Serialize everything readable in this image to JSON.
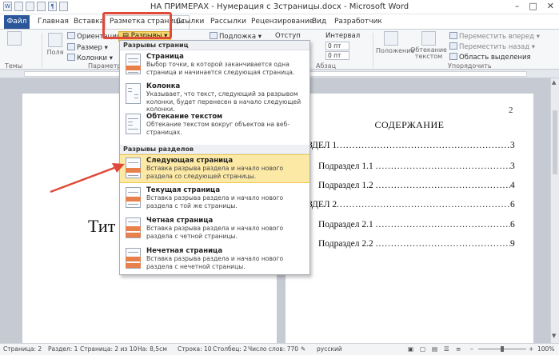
{
  "window": {
    "title": "НА ПРИМЕРАХ - Нумерация с 3страницы.docx - Microsoft Word",
    "controls": [
      "–",
      "□",
      "✕"
    ],
    "qat_icons": [
      "word-logo-icon",
      "save-icon",
      "undo-icon",
      "redo-icon",
      "paragraph-mark-icon",
      "format-painter-icon"
    ]
  },
  "tabs": [
    "Файл",
    "Главная",
    "Вставка",
    "Разметка страницы",
    "Ссылки",
    "Рассылки",
    "Рецензирование",
    "Вид",
    "Разработчик"
  ],
  "ribbon": {
    "themes_label": "Темы",
    "fields_label": "Поля",
    "orientation_label": "Ориентация",
    "size_label": "Размер",
    "columns_label": "Колонки",
    "breaks_label": "Разрывы",
    "params_group": "Параметры",
    "watermark_label": "Подложка",
    "indent_label": "Отступ",
    "interval_label": "Интервал",
    "spacing_before": "0 пт",
    "spacing_after": "0 пт",
    "paragraph_group": "Абзац",
    "position_label": "Положение",
    "wrap_label": "Обтекание текстом",
    "forward_label": "Переместить вперед",
    "back_label": "Переместить назад",
    "selection_label": "Область выделения",
    "arrange_group": "Упорядочить"
  },
  "menu": {
    "page_breaks_header": "Разрывы страниц",
    "section_breaks_header": "Разрывы разделов",
    "page_breaks": [
      {
        "title": "Страница",
        "desc": "Выбор точки, в которой заканчивается одна страница и начинается следующая страница."
      },
      {
        "title": "Колонка",
        "desc": "Указывает, что текст, следующий за разрывом колонки, будет перенесен в начало следующей колонки."
      },
      {
        "title": "Обтекание текстом",
        "desc": "Обтекание текстом вокруг объектов на веб-страницах."
      }
    ],
    "section_breaks": [
      {
        "title": "Следующая страница",
        "desc": "Вставка разрыва раздела и начало нового раздела со следующей страницы."
      },
      {
        "title": "Текущая страница",
        "desc": "Вставка разрыва раздела и начало нового раздела с той же страницы."
      },
      {
        "title": "Четная страница",
        "desc": "Вставка разрыва раздела и начало нового раздела с четной страницы."
      },
      {
        "title": "Нечетная страница",
        "desc": "Вставка разрыва раздела и начало нового раздела с нечетной страницы."
      }
    ]
  },
  "document": {
    "page1_text": "Тит",
    "page2_number": "2",
    "toc_title": "СОДЕРЖАНИЕ",
    "toc": [
      {
        "label": "РАЗДЕЛ 1",
        "dots": "........................................................",
        "page": "3"
      },
      {
        "label": "Подраздел 1.1",
        "dots": "..............................................",
        "page": "3"
      },
      {
        "label": "Подраздел 1.2",
        "dots": "..............................................",
        "page": "4"
      },
      {
        "label": "РАЗДЕЛ 2",
        "dots": "........................................................",
        "page": "6"
      },
      {
        "label": "Подраздел 2.1",
        "dots": "..............................................",
        "page": "6"
      },
      {
        "label": "Подраздел 2.2",
        "dots": "..............................................",
        "page": "9"
      }
    ]
  },
  "status": {
    "page": "Страница: 2",
    "section": "Раздел: 1",
    "page_of": "Страница: 2 из 10",
    "at": "На: 8,5см",
    "line": "Строка: 10",
    "column": "Столбец: 2",
    "words": "Число слов: 770",
    "language": "русский",
    "zoom": "100%"
  },
  "colors": {
    "file_tab": "#2b579a",
    "highlight": "#fde9a6",
    "annotation_red": "#e04a3a"
  }
}
